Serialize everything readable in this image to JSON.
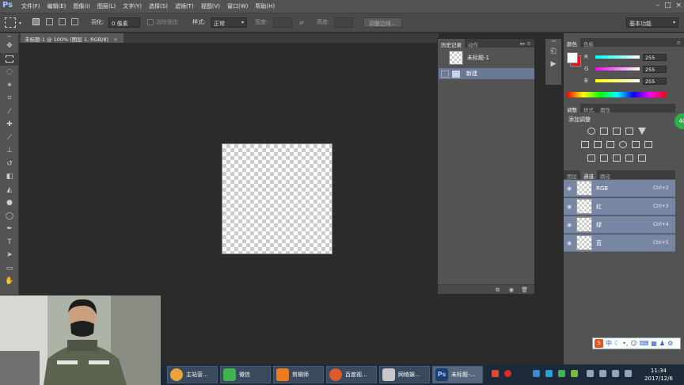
{
  "app": {
    "logo": "Ps"
  },
  "menu": [
    "文件(F)",
    "编辑(E)",
    "图像(I)",
    "图层(L)",
    "文字(Y)",
    "选择(S)",
    "滤镜(T)",
    "视图(V)",
    "窗口(W)",
    "帮助(H)"
  ],
  "window_controls": {
    "minimize": "–",
    "maximize": "□",
    "close": "×"
  },
  "options": {
    "feather_label": "羽化:",
    "feather_value": "0 像素",
    "antialias_label": "消除锯齿",
    "style_label": "样式:",
    "style_value": "正常",
    "width_label": "宽度:",
    "height_label": "高度:",
    "refine_edge": "调整边缘...",
    "workspace": "基本功能"
  },
  "document": {
    "tab_title": "未标题-1 @ 100% (图层 1, RGB/8)"
  },
  "history_panel": {
    "tabs": [
      "历史记录",
      "动作"
    ],
    "snapshot_name": "未标题-1",
    "items": [
      "新建"
    ]
  },
  "color_panel": {
    "tabs": [
      "颜色",
      "色板"
    ],
    "channels": [
      {
        "label": "R",
        "value": "255"
      },
      {
        "label": "G",
        "value": "255"
      },
      {
        "label": "B",
        "value": "255"
      }
    ],
    "foreground": "#ffffff",
    "background": "#e0141b"
  },
  "adjust_panel": {
    "tabs": [
      "调整",
      "样式",
      "属性"
    ],
    "title": "添加调整",
    "badge": "40"
  },
  "channels_panel": {
    "tabs": [
      "图层",
      "通道",
      "路径"
    ],
    "rows": [
      {
        "name": "RGB",
        "shortcut": "Ctrl+2"
      },
      {
        "name": "红",
        "shortcut": "Ctrl+3"
      },
      {
        "name": "绿",
        "shortcut": "Ctrl+4"
      },
      {
        "name": "蓝",
        "shortcut": "Ctrl+5"
      }
    ]
  },
  "taskbar": {
    "apps": [
      {
        "label": "主站营...",
        "color": "#e8a43a"
      },
      {
        "label": "微信",
        "color": "#3fb34f"
      },
      {
        "label": "剪辑师",
        "color": "#f07a1e"
      },
      {
        "label": "百度视...",
        "color": "#e05a2a"
      },
      {
        "label": "网络娱...",
        "color": "#c8c8c8"
      },
      {
        "label": "未标题-...",
        "color": "#1c3e6e"
      }
    ],
    "time": "11:34",
    "date": "2017/12/6"
  },
  "ime": {
    "lang": "中"
  }
}
